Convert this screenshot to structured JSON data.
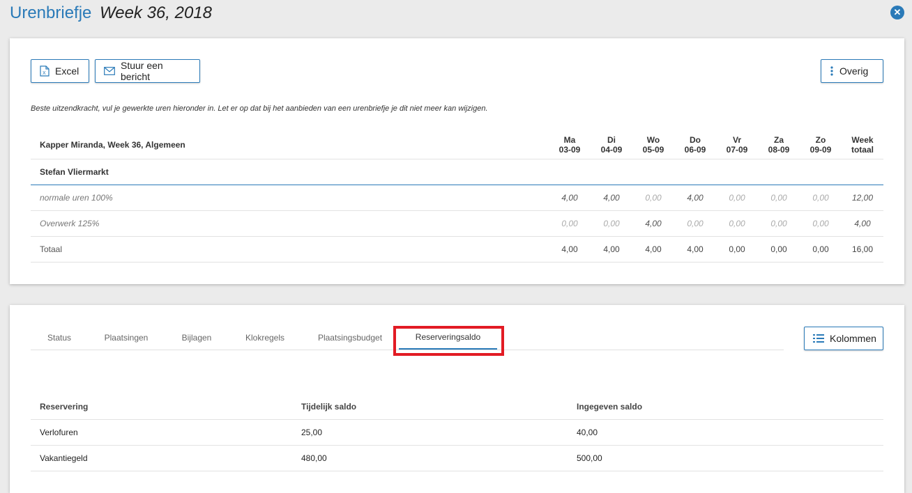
{
  "header": {
    "title": "Urenbriefje",
    "week": "Week 36, 2018",
    "close_icon": "close-circle-icon"
  },
  "toolbar": {
    "excel_label": "Excel",
    "message_label": "Stuur een bericht",
    "more_label": "Overig"
  },
  "intro_text": "Beste uitzendkracht, vul je gewerkte uren hieronder in. Let er op dat bij het aanbieden van een urenbriefje je dit niet meer kan wijzigen.",
  "hours_table": {
    "caption": "Kapper Miranda, Week 36, Algemeen",
    "columns": [
      {
        "day": "Ma",
        "date": "03-09"
      },
      {
        "day": "Di",
        "date": "04-09"
      },
      {
        "day": "Wo",
        "date": "05-09"
      },
      {
        "day": "Do",
        "date": "06-09"
      },
      {
        "day": "Vr",
        "date": "07-09"
      },
      {
        "day": "Za",
        "date": "08-09"
      },
      {
        "day": "Zo",
        "date": "09-09"
      },
      {
        "day": "Week",
        "date": "totaal"
      }
    ],
    "person": "Stefan Vliermarkt",
    "rows": [
      {
        "label": "normale uren 100%",
        "values": [
          "4,00",
          "4,00",
          "0,00",
          "4,00",
          "0,00",
          "0,00",
          "0,00",
          "12,00"
        ]
      },
      {
        "label": "Overwerk 125%",
        "values": [
          "0,00",
          "0,00",
          "4,00",
          "0,00",
          "0,00",
          "0,00",
          "0,00",
          "4,00"
        ]
      }
    ],
    "total": {
      "label": "Totaal",
      "values": [
        "4,00",
        "4,00",
        "4,00",
        "4,00",
        "0,00",
        "0,00",
        "0,00",
        "16,00"
      ]
    }
  },
  "tabs": [
    {
      "label": "Status"
    },
    {
      "label": "Plaatsingen"
    },
    {
      "label": "Bijlagen"
    },
    {
      "label": "Klokregels"
    },
    {
      "label": "Plaatsingsbudget"
    },
    {
      "label": "Reserveringsaldo"
    }
  ],
  "active_tab": "Reserveringsaldo",
  "columns_button_label": "Kolommen",
  "reservations": {
    "headers": [
      "Reservering",
      "Tijdelijk saldo",
      "Ingegeven saldo"
    ],
    "rows": [
      [
        "Verlofuren",
        "25,00",
        "40,00"
      ],
      [
        "Vakantiegeld",
        "480,00",
        "500,00"
      ]
    ]
  },
  "colors": {
    "accent": "#2a7ab8",
    "highlight": "#e21b24"
  }
}
